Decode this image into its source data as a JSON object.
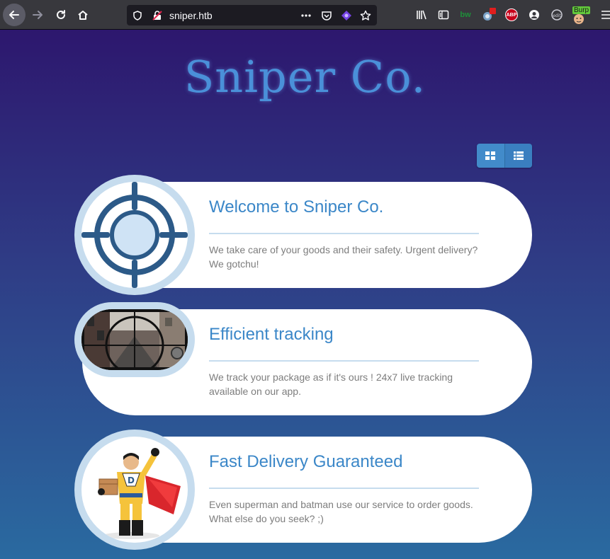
{
  "browser": {
    "url": "sniper.htb",
    "extensions": {
      "bw_label": "bw",
      "abp_label": "ABP",
      "burp_label": "Burp"
    }
  },
  "page": {
    "site_title": "Sniper Co.",
    "cards": [
      {
        "title": "Welcome to Sniper Co.",
        "text": "We take care of your goods and their safety. Urgent delivery? We gotchu!",
        "image": "crosshair-icon"
      },
      {
        "title": "Efficient tracking",
        "text": "We track your package as if it's ours ! 24x7 live tracking available on our app.",
        "image": "scope-street-view"
      },
      {
        "title": "Fast Delivery Guaranteed",
        "text": "Even superman and batman use our service to order goods. What else do you seek? ;)",
        "image": "delivery-superhero"
      }
    ]
  },
  "colors": {
    "accent": "#3b87c8",
    "circle_ring": "#c6dcee",
    "crosshair": "#2c5a88",
    "toggle": "#428bca"
  }
}
